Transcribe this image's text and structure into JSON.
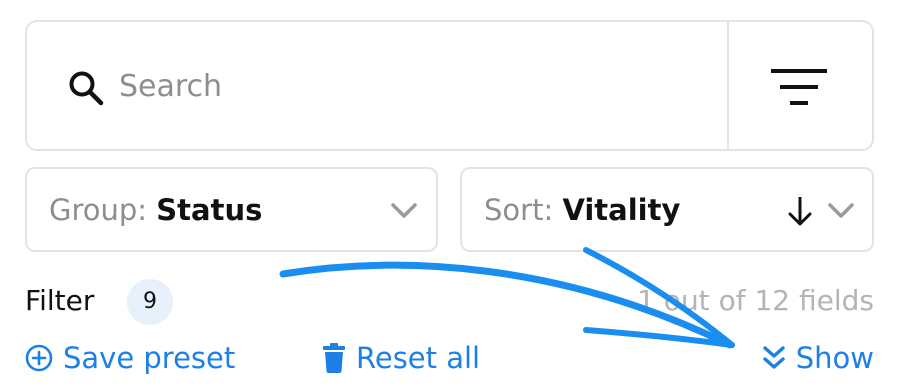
{
  "search": {
    "placeholder": "Search",
    "value": ""
  },
  "group_select": {
    "prefix": "Group:",
    "value": "Status"
  },
  "sort_select": {
    "prefix": "Sort:",
    "value": "Vitality"
  },
  "filter": {
    "label": "Filter",
    "count": "9",
    "fields_text": "1 out of 12 fields"
  },
  "actions": {
    "save_preset": "Save preset",
    "reset_all": "Reset all",
    "show": "Show"
  },
  "icons": {
    "search": "search-icon",
    "filter": "filter-lines-icon",
    "chevron": "chevron-down-icon",
    "sort_direction": "arrow-down-icon",
    "save": "plus-circle-icon",
    "reset": "trash-icon",
    "show": "double-chevron-down-icon"
  },
  "colors": {
    "accent": "#1e7fe6",
    "annotation": "#1a8df0",
    "badge_bg": "#e6f1fb",
    "muted_text": "#8e8e8e",
    "border": "#e3e3e3"
  }
}
